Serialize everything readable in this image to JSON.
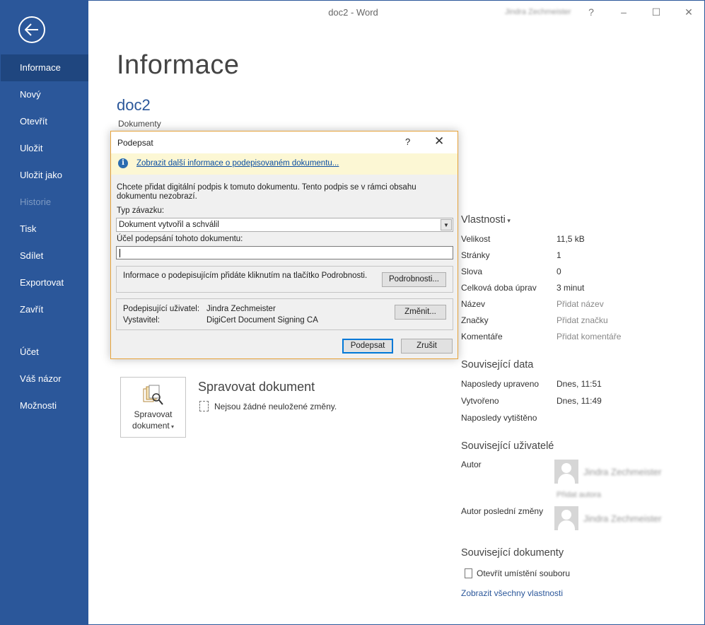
{
  "window": {
    "title": "doc2  -  Word",
    "user_name": "Jindra Zechmeister",
    "help_label": "?",
    "minimize_label": "–",
    "maximize_label": "☐",
    "close_label": "✕"
  },
  "sidebar": {
    "items": [
      {
        "label": "Informace",
        "state": "active"
      },
      {
        "label": "Nový"
      },
      {
        "label": "Otevřít"
      },
      {
        "label": "Uložit"
      },
      {
        "label": "Uložit jako"
      },
      {
        "label": "Historie",
        "state": "disabled"
      },
      {
        "label": "Tisk"
      },
      {
        "label": "Sdílet"
      },
      {
        "label": "Exportovat"
      },
      {
        "label": "Zavřít"
      },
      {
        "label": "Účet"
      },
      {
        "label": "Váš názor"
      },
      {
        "label": "Možnosti"
      }
    ]
  },
  "main": {
    "page_title": "Informace",
    "doc_name": "doc2",
    "doc_location": "Dokumenty"
  },
  "manage": {
    "tile_label_1": "Spravovat",
    "tile_label_2": "dokument",
    "title": "Spravovat dokument",
    "status": "Nejsou žádné neuložené změny."
  },
  "properties": {
    "heading": "Vlastnosti",
    "rows": [
      {
        "label": "Velikost",
        "value": "11,5 kB"
      },
      {
        "label": "Stránky",
        "value": "1"
      },
      {
        "label": "Slova",
        "value": "0"
      },
      {
        "label": "Celková doba úprav",
        "value": "3 minut"
      },
      {
        "label": "Název",
        "value": "Přidat název"
      },
      {
        "label": "Značky",
        "value": "Přidat značku"
      },
      {
        "label": "Komentáře",
        "value": "Přidat komentáře"
      }
    ]
  },
  "related_dates": {
    "heading": "Související data",
    "rows": [
      {
        "label": "Naposledy upraveno",
        "value": "Dnes, 11:51"
      },
      {
        "label": "Vytvořeno",
        "value": "Dnes, 11:49"
      },
      {
        "label": "Naposledy vytištěno",
        "value": ""
      }
    ]
  },
  "related_people": {
    "heading": "Související uživatelé",
    "author_label": "Autor",
    "author_name": "Jindra Zechmeister",
    "add_author": "Přidat autora",
    "last_modified_label": "Autor poslední změny",
    "last_modified_name": "Jindra Zechmeister"
  },
  "related_docs": {
    "heading": "Související dokumenty",
    "open_location": "Otevřít umístění souboru",
    "show_all": "Zobrazit všechny vlastnosti"
  },
  "dialog": {
    "title": "Podepsat",
    "help": "?",
    "close": "✕",
    "info_link": "Zobrazit další informace o podepisovaném dokumentu...",
    "intro": "Chcete přidat digitální podpis k tomuto dokumentu. Tento podpis se v rámci obsahu dokumentu nezobrazí.",
    "commitment_label": "Typ závazku:",
    "commitment_value": "Dokument vytvořil a schválil",
    "purpose_label": "Účel podepsání tohoto dokumentu:",
    "purpose_value": "",
    "details_text": "Informace o podepisujícím přidáte kliknutím na tlačítko Podrobnosti.",
    "details_button": "Podrobnosti...",
    "signer_label": "Podepisující uživatel:",
    "signer_value": "Jindra Zechmeister",
    "issuer_label": "Vystavitel:",
    "issuer_value": "DigiCert Document Signing CA",
    "change_button": "Změnit...",
    "sign_button": "Podepsat",
    "cancel_button": "Zrušit"
  },
  "colors": {
    "accent": "#2b579a",
    "sidebar_active": "#1f467f",
    "dialog_border": "#e6a33a",
    "infobar": "#fcf7d4"
  }
}
